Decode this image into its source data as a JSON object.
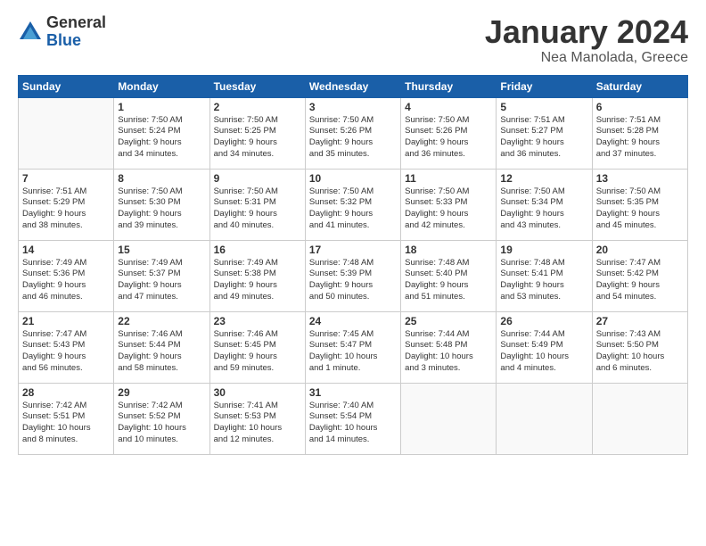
{
  "logo": {
    "general": "General",
    "blue": "Blue"
  },
  "header": {
    "month": "January 2024",
    "location": "Nea Manolada, Greece"
  },
  "weekdays": [
    "Sunday",
    "Monday",
    "Tuesday",
    "Wednesday",
    "Thursday",
    "Friday",
    "Saturday"
  ],
  "weeks": [
    [
      {
        "day": "",
        "info": ""
      },
      {
        "day": "1",
        "info": "Sunrise: 7:50 AM\nSunset: 5:24 PM\nDaylight: 9 hours\nand 34 minutes."
      },
      {
        "day": "2",
        "info": "Sunrise: 7:50 AM\nSunset: 5:25 PM\nDaylight: 9 hours\nand 34 minutes."
      },
      {
        "day": "3",
        "info": "Sunrise: 7:50 AM\nSunset: 5:26 PM\nDaylight: 9 hours\nand 35 minutes."
      },
      {
        "day": "4",
        "info": "Sunrise: 7:50 AM\nSunset: 5:26 PM\nDaylight: 9 hours\nand 36 minutes."
      },
      {
        "day": "5",
        "info": "Sunrise: 7:51 AM\nSunset: 5:27 PM\nDaylight: 9 hours\nand 36 minutes."
      },
      {
        "day": "6",
        "info": "Sunrise: 7:51 AM\nSunset: 5:28 PM\nDaylight: 9 hours\nand 37 minutes."
      }
    ],
    [
      {
        "day": "7",
        "info": "Sunrise: 7:51 AM\nSunset: 5:29 PM\nDaylight: 9 hours\nand 38 minutes."
      },
      {
        "day": "8",
        "info": "Sunrise: 7:50 AM\nSunset: 5:30 PM\nDaylight: 9 hours\nand 39 minutes."
      },
      {
        "day": "9",
        "info": "Sunrise: 7:50 AM\nSunset: 5:31 PM\nDaylight: 9 hours\nand 40 minutes."
      },
      {
        "day": "10",
        "info": "Sunrise: 7:50 AM\nSunset: 5:32 PM\nDaylight: 9 hours\nand 41 minutes."
      },
      {
        "day": "11",
        "info": "Sunrise: 7:50 AM\nSunset: 5:33 PM\nDaylight: 9 hours\nand 42 minutes."
      },
      {
        "day": "12",
        "info": "Sunrise: 7:50 AM\nSunset: 5:34 PM\nDaylight: 9 hours\nand 43 minutes."
      },
      {
        "day": "13",
        "info": "Sunrise: 7:50 AM\nSunset: 5:35 PM\nDaylight: 9 hours\nand 45 minutes."
      }
    ],
    [
      {
        "day": "14",
        "info": "Sunrise: 7:49 AM\nSunset: 5:36 PM\nDaylight: 9 hours\nand 46 minutes."
      },
      {
        "day": "15",
        "info": "Sunrise: 7:49 AM\nSunset: 5:37 PM\nDaylight: 9 hours\nand 47 minutes."
      },
      {
        "day": "16",
        "info": "Sunrise: 7:49 AM\nSunset: 5:38 PM\nDaylight: 9 hours\nand 49 minutes."
      },
      {
        "day": "17",
        "info": "Sunrise: 7:48 AM\nSunset: 5:39 PM\nDaylight: 9 hours\nand 50 minutes."
      },
      {
        "day": "18",
        "info": "Sunrise: 7:48 AM\nSunset: 5:40 PM\nDaylight: 9 hours\nand 51 minutes."
      },
      {
        "day": "19",
        "info": "Sunrise: 7:48 AM\nSunset: 5:41 PM\nDaylight: 9 hours\nand 53 minutes."
      },
      {
        "day": "20",
        "info": "Sunrise: 7:47 AM\nSunset: 5:42 PM\nDaylight: 9 hours\nand 54 minutes."
      }
    ],
    [
      {
        "day": "21",
        "info": "Sunrise: 7:47 AM\nSunset: 5:43 PM\nDaylight: 9 hours\nand 56 minutes."
      },
      {
        "day": "22",
        "info": "Sunrise: 7:46 AM\nSunset: 5:44 PM\nDaylight: 9 hours\nand 58 minutes."
      },
      {
        "day": "23",
        "info": "Sunrise: 7:46 AM\nSunset: 5:45 PM\nDaylight: 9 hours\nand 59 minutes."
      },
      {
        "day": "24",
        "info": "Sunrise: 7:45 AM\nSunset: 5:47 PM\nDaylight: 10 hours\nand 1 minute."
      },
      {
        "day": "25",
        "info": "Sunrise: 7:44 AM\nSunset: 5:48 PM\nDaylight: 10 hours\nand 3 minutes."
      },
      {
        "day": "26",
        "info": "Sunrise: 7:44 AM\nSunset: 5:49 PM\nDaylight: 10 hours\nand 4 minutes."
      },
      {
        "day": "27",
        "info": "Sunrise: 7:43 AM\nSunset: 5:50 PM\nDaylight: 10 hours\nand 6 minutes."
      }
    ],
    [
      {
        "day": "28",
        "info": "Sunrise: 7:42 AM\nSunset: 5:51 PM\nDaylight: 10 hours\nand 8 minutes."
      },
      {
        "day": "29",
        "info": "Sunrise: 7:42 AM\nSunset: 5:52 PM\nDaylight: 10 hours\nand 10 minutes."
      },
      {
        "day": "30",
        "info": "Sunrise: 7:41 AM\nSunset: 5:53 PM\nDaylight: 10 hours\nand 12 minutes."
      },
      {
        "day": "31",
        "info": "Sunrise: 7:40 AM\nSunset: 5:54 PM\nDaylight: 10 hours\nand 14 minutes."
      },
      {
        "day": "",
        "info": ""
      },
      {
        "day": "",
        "info": ""
      },
      {
        "day": "",
        "info": ""
      }
    ]
  ]
}
